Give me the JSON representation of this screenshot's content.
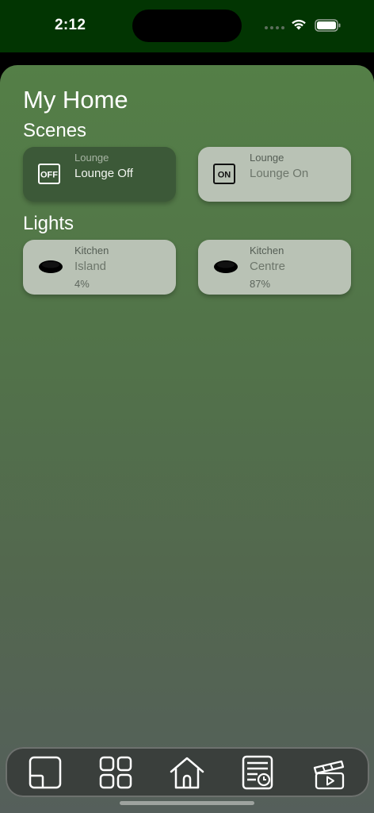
{
  "status_bar": {
    "time": "2:12",
    "icons": [
      "signal-dots-icon",
      "wifi-icon",
      "battery-icon"
    ]
  },
  "page": {
    "title": "My Home"
  },
  "scenes": {
    "heading": "Scenes",
    "items": [
      {
        "room": "Lounge",
        "name": "Lounge Off",
        "badge": "OFF",
        "icon": "scene-off-icon",
        "active": true
      },
      {
        "room": "Lounge",
        "name": "Lounge On",
        "badge": "ON",
        "icon": "scene-on-icon",
        "active": false
      }
    ]
  },
  "lights": {
    "heading": "Lights",
    "items": [
      {
        "room": "Kitchen",
        "name": "Island",
        "level": "4%",
        "icon": "downlight-icon"
      },
      {
        "room": "Kitchen",
        "name": "Centre",
        "level": "87%",
        "icon": "downlight-icon"
      }
    ]
  },
  "tab_bar": {
    "tabs": [
      {
        "icon": "floorplan-icon"
      },
      {
        "icon": "grid-icon"
      },
      {
        "icon": "home-icon"
      },
      {
        "icon": "schedule-icon"
      },
      {
        "icon": "scene-clapper-icon"
      }
    ]
  },
  "colors": {
    "status_bar_bg": "#023502",
    "background_top": "#547f47",
    "background_bottom": "#555f5b",
    "card_light": "#b9c2b5",
    "card_active": "#3c5938",
    "tab_bar_bg": "#3a3f3c"
  }
}
